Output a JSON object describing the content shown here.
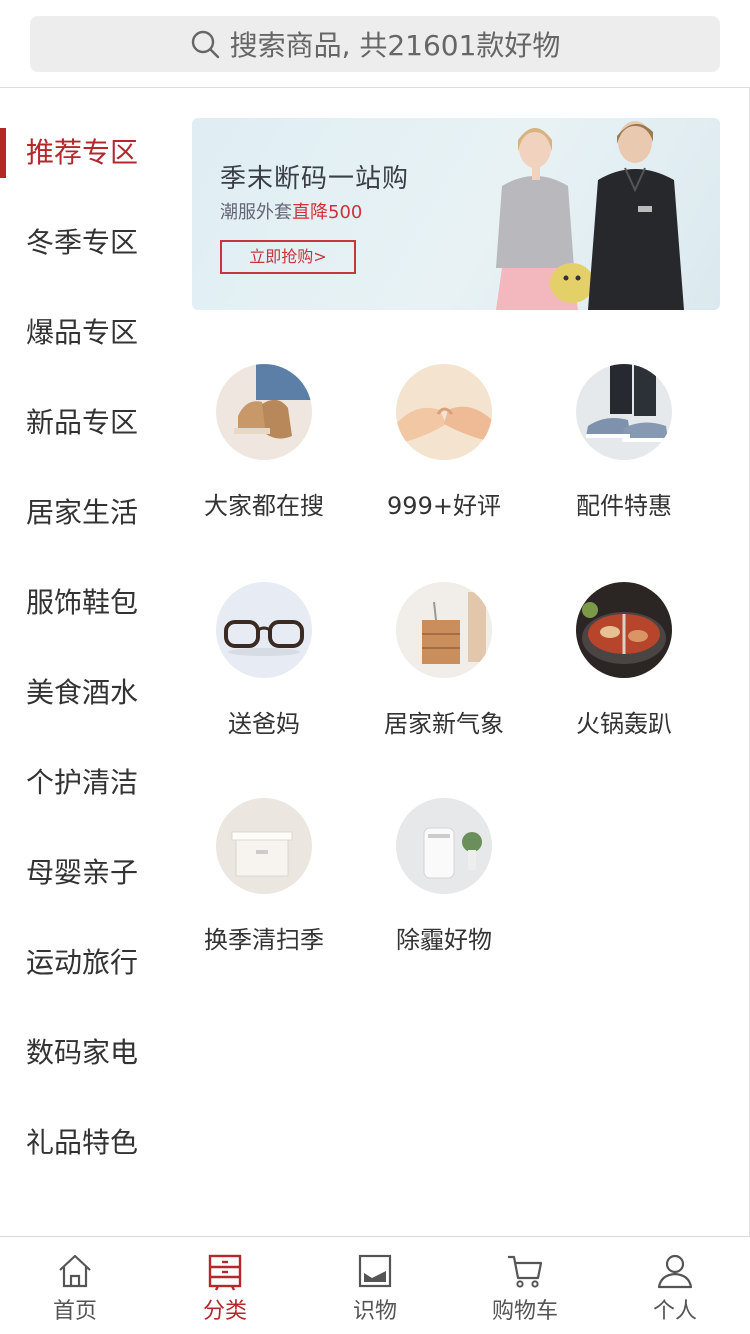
{
  "search": {
    "placeholder": "搜索商品, 共21601款好物",
    "icon": "search-icon"
  },
  "sidebar": {
    "items": [
      {
        "label": "推荐专区",
        "active": true
      },
      {
        "label": "冬季专区",
        "active": false
      },
      {
        "label": "爆品专区",
        "active": false
      },
      {
        "label": "新品专区",
        "active": false
      },
      {
        "label": "居家生活",
        "active": false
      },
      {
        "label": "服饰鞋包",
        "active": false
      },
      {
        "label": "美食酒水",
        "active": false
      },
      {
        "label": "个护清洁",
        "active": false
      },
      {
        "label": "母婴亲子",
        "active": false
      },
      {
        "label": "运动旅行",
        "active": false
      },
      {
        "label": "数码家电",
        "active": false
      },
      {
        "label": "礼品特色",
        "active": false
      }
    ]
  },
  "banner": {
    "title": "季末断码一站购",
    "sub_prefix": "潮服外套",
    "sub_highlight": "直降500",
    "button": "立即抢购>"
  },
  "categories": [
    {
      "label": "大家都在搜",
      "icon": "boots-photo"
    },
    {
      "label": "999+好评",
      "icon": "pinky-promise-photo"
    },
    {
      "label": "配件特惠",
      "icon": "sneakers-photo"
    },
    {
      "label": "送爸妈",
      "icon": "glasses-photo"
    },
    {
      "label": "居家新气象",
      "icon": "cabinet-photo"
    },
    {
      "label": "火锅轰趴",
      "icon": "hotpot-photo"
    },
    {
      "label": "换季清扫季",
      "icon": "storage-box-photo"
    },
    {
      "label": "除霾好物",
      "icon": "air-purifier-photo"
    }
  ],
  "tabbar": {
    "items": [
      {
        "label": "首页",
        "icon": "home-icon",
        "active": false
      },
      {
        "label": "分类",
        "icon": "category-icon",
        "active": true
      },
      {
        "label": "识物",
        "icon": "picture-icon",
        "active": false
      },
      {
        "label": "购物车",
        "icon": "cart-icon",
        "active": false
      },
      {
        "label": "个人",
        "icon": "person-icon",
        "active": false
      }
    ]
  },
  "colors": {
    "accent": "#b4282d",
    "search_bg": "#ededed"
  }
}
